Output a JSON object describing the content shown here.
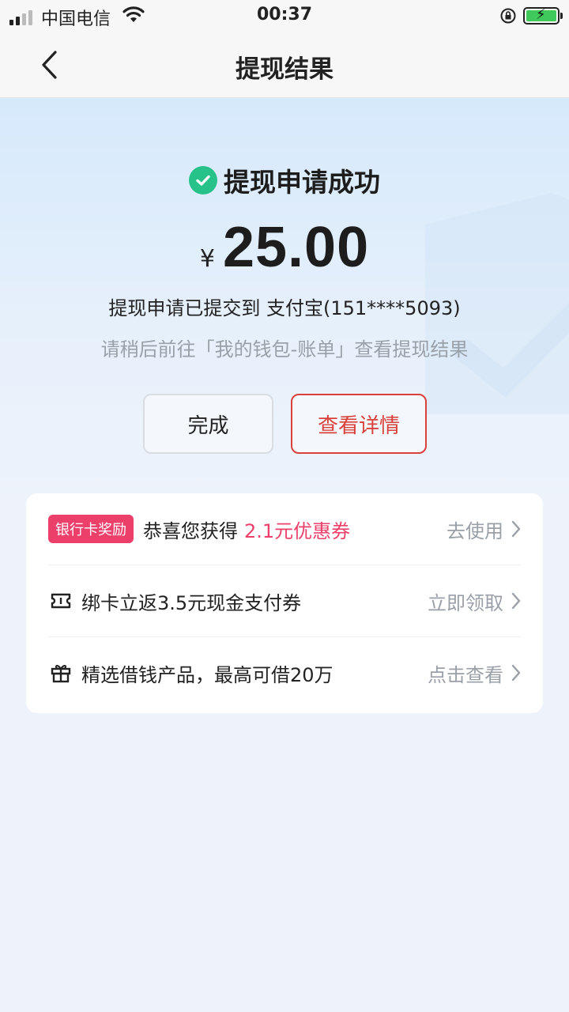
{
  "status_bar": {
    "carrier": "中国电信",
    "time": "00:37"
  },
  "nav": {
    "title": "提现结果"
  },
  "result": {
    "title": "提现申请成功",
    "currency": "¥",
    "amount": "25.00",
    "submitted_text": "提现申请已提交到 支付宝(151****5093)",
    "hint": "请稍后前往「我的钱包-账单」查看提现结果"
  },
  "buttons": {
    "done": "完成",
    "detail": "查看详情"
  },
  "card": {
    "rows": [
      {
        "badge": "银行卡奖励",
        "text": "恭喜您获得",
        "highlight": "2.1元优惠券",
        "action": "去使用",
        "icon": "badge"
      },
      {
        "text": "绑卡立返3.5元现金支付券",
        "action": "立即领取",
        "icon": "ticket-icon"
      },
      {
        "text": "精选借钱产品，最高可借20万",
        "action": "点击查看",
        "icon": "gift-icon"
      }
    ]
  },
  "colors": {
    "accent_red": "#d9413a",
    "badge_pink": "#ec3f6a",
    "success_green": "#27c28a"
  }
}
